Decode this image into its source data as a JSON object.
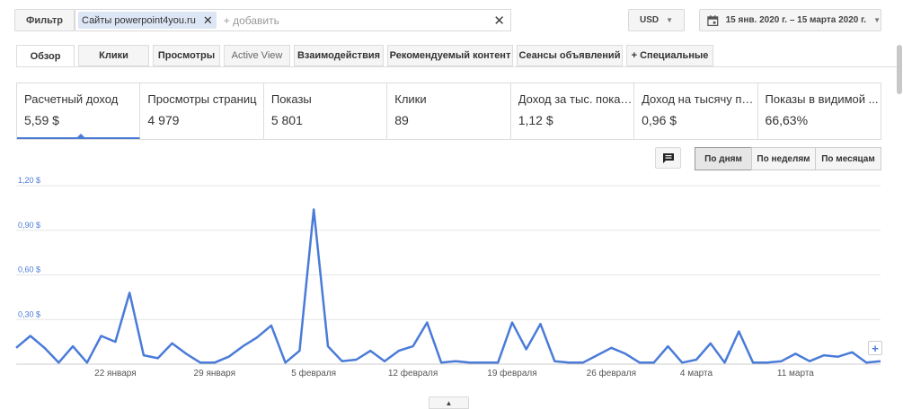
{
  "toolbar": {
    "filter_label": "Фильтр",
    "chip_label": "Сайты powerpoint4you.ru",
    "chip_close": "✕",
    "add_placeholder": "+ добавить",
    "clear_glyph": "✕",
    "currency": "USD",
    "date_range": "15 янв. 2020 г. – 15 марта 2020 г.",
    "calendar_icon": "calendar-icon"
  },
  "tabs": [
    {
      "label": "Обзор"
    },
    {
      "label": "Клики"
    },
    {
      "label": "Просмотры"
    },
    {
      "label": "Active View"
    },
    {
      "label": "Взаимодействия"
    },
    {
      "label": "Рекомендуемый контент"
    },
    {
      "label": "Сеансы объявлений"
    },
    {
      "label": "+  Специальные"
    }
  ],
  "metrics": [
    {
      "label": "Расчетный доход",
      "value": "5,59 $"
    },
    {
      "label": "Просмотры страниц",
      "value": "4 979"
    },
    {
      "label": "Показы",
      "value": "5 801"
    },
    {
      "label": "Клики",
      "value": "89"
    },
    {
      "label": "Доход за тыс. показов",
      "value": "1,12 $"
    },
    {
      "label": "Доход на тысячу по...",
      "value": "0,96 $"
    },
    {
      "label": "Показы в видимой ...",
      "value": "66,63%"
    }
  ],
  "period": {
    "daily": "По дням",
    "weekly": "По неделям",
    "monthly": "По месяцам"
  },
  "zoom_glyph": "+",
  "collapse_glyph": "▲",
  "colors": {
    "line": "#4a7bd8",
    "tick_label": "#4a7bd8",
    "grid": "#e5e5e5"
  },
  "chart_data": {
    "type": "line",
    "ylim": [
      0,
      1.2
    ],
    "y_ticks": [
      {
        "value": 0.3,
        "label": "0,30 $"
      },
      {
        "value": 0.6,
        "label": "0,60 $"
      },
      {
        "value": 0.9,
        "label": "0,90 $"
      },
      {
        "value": 1.2,
        "label": "1,20 $"
      }
    ],
    "x_ticks": [
      {
        "index": 7,
        "label": "22 января"
      },
      {
        "index": 14,
        "label": "29 января"
      },
      {
        "index": 21,
        "label": "5 февраля"
      },
      {
        "index": 28,
        "label": "12 февраля"
      },
      {
        "index": 35,
        "label": "19 февраля"
      },
      {
        "index": 42,
        "label": "26 февраля"
      },
      {
        "index": 48,
        "label": "4 марта"
      },
      {
        "index": 55,
        "label": "11 марта"
      }
    ],
    "series": [
      {
        "values": [
          0.11,
          0.19,
          0.11,
          0.01,
          0.12,
          0.01,
          0.19,
          0.15,
          0.48,
          0.06,
          0.04,
          0.14,
          0.07,
          0.01,
          0.01,
          0.05,
          0.12,
          0.18,
          0.26,
          0.01,
          0.09,
          1.04,
          0.12,
          0.02,
          0.03,
          0.09,
          0.02,
          0.09,
          0.12,
          0.28,
          0.01,
          0.02,
          0.01,
          0.01,
          0.01,
          0.28,
          0.1,
          0.27,
          0.02,
          0.01,
          0.01,
          0.06,
          0.11,
          0.07,
          0.01,
          0.01,
          0.12,
          0.01,
          0.03,
          0.14,
          0.01,
          0.22,
          0.01,
          0.01,
          0.02,
          0.07,
          0.02,
          0.06,
          0.05,
          0.08,
          0.01,
          0.02
        ]
      }
    ]
  }
}
